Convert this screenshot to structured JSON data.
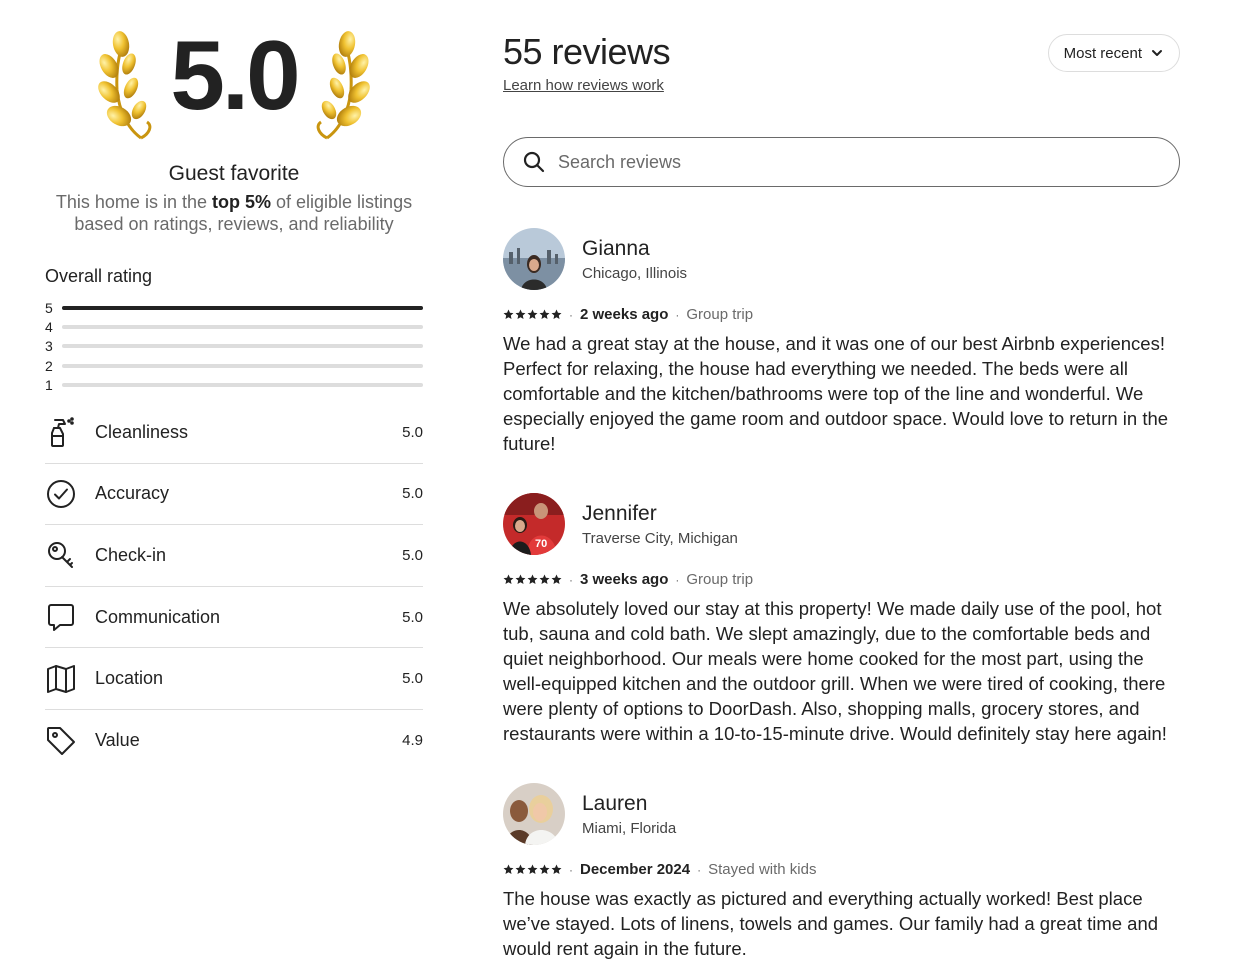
{
  "summary": {
    "score": "5.0",
    "badge_title": "Guest favorite",
    "desc_prefix": "This home is in the ",
    "desc_bold": "top 5%",
    "desc_suffix": " of eligible listings based on ratings, reviews, and reliability"
  },
  "overall": {
    "title": "Overall rating",
    "bars": [
      {
        "label": "5",
        "fraction": 1.0
      },
      {
        "label": "4",
        "fraction": 0.0
      },
      {
        "label": "3",
        "fraction": 0.0
      },
      {
        "label": "2",
        "fraction": 0.0
      },
      {
        "label": "1",
        "fraction": 0.0
      }
    ]
  },
  "categories": [
    {
      "label": "Cleanliness",
      "value": "5.0",
      "icon": "spray-bottle-icon"
    },
    {
      "label": "Accuracy",
      "value": "5.0",
      "icon": "check-circle-icon"
    },
    {
      "label": "Check-in",
      "value": "5.0",
      "icon": "key-icon"
    },
    {
      "label": "Communication",
      "value": "5.0",
      "icon": "chat-bubble-icon"
    },
    {
      "label": "Location",
      "value": "5.0",
      "icon": "map-icon"
    },
    {
      "label": "Value",
      "value": "4.9",
      "icon": "tag-icon"
    }
  ],
  "header": {
    "count": "55 reviews",
    "learn_link": "Learn how reviews work",
    "sort_label": "Most recent"
  },
  "search": {
    "placeholder": "Search reviews"
  },
  "reviews": [
    {
      "name": "Gianna",
      "location": "Chicago, Illinois",
      "rating": 5,
      "date": "2 weeks ago",
      "trip": "Group trip",
      "text": "We had a great stay at the house, and it was one of our best Airbnb experiences! Perfect for relaxing, the house had everything we needed. The beds were all comfortable and the kitchen/bathrooms were top of the line and wonderful. We especially enjoyed the game room and outdoor space. Would love to return in the future!"
    },
    {
      "name": "Jennifer",
      "location": "Traverse City, Michigan",
      "rating": 5,
      "date": "3 weeks ago",
      "trip": "Group trip",
      "text": "We absolutely loved our stay at this property! We made daily use of the pool, hot tub, sauna and cold bath. We slept amazingly, due to the comfortable beds and quiet neighborhood. Our meals were home cooked for the most part, using the well-equipped kitchen and the outdoor grill. When we were tired of cooking, there were plenty of options to DoorDash. Also, shopping malls, grocery stores, and restaurants were within a 10-to-15-minute drive. Would definitely stay here again!"
    },
    {
      "name": "Lauren",
      "location": "Miami, Florida",
      "rating": 5,
      "date": "December 2024",
      "trip": "Stayed with kids",
      "text": "The house was exactly as pictured and everything actually worked! Best place we’ve stayed. Lots of linens, towels and games. Our family had a great time and would rent again in the future."
    }
  ],
  "colors": {
    "text": "#222222",
    "muted": "#6a6a6a",
    "divider": "#dddddd",
    "laurel_gold": "#e8b41c"
  }
}
